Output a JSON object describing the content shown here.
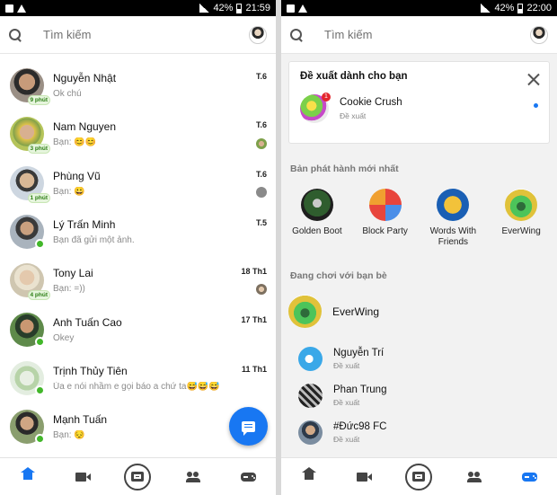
{
  "left": {
    "status": {
      "battery": "42%",
      "time": "21:59"
    },
    "search_placeholder": "Tìm kiếm",
    "conversations": [
      {
        "name": "Nguyễn Nhật",
        "msg": "Ok chú",
        "time": "T.6",
        "badge": "9 phút"
      },
      {
        "name": "Nam Nguyen",
        "msg": "Bạn: 😊😊",
        "time": "T.6",
        "badge": "3 phút"
      },
      {
        "name": "Phùng Vũ",
        "msg": "Bạn: 😀",
        "time": "T.6",
        "badge": "1 phút"
      },
      {
        "name": "Lý Trấn Minh",
        "msg": "Bạn đã gửi một ảnh.",
        "time": "T.5",
        "badge": ""
      },
      {
        "name": "Tony Lai",
        "msg": "Bạn: =))",
        "time": "18 Th1",
        "badge": "4 phút"
      },
      {
        "name": "Anh Tuấn Cao",
        "msg": "Okey",
        "time": "17 Th1",
        "badge": ""
      },
      {
        "name": "Trịnh Thủy Tiên",
        "msg": "Ủa e nói nhầm e gọi báo a chứ ta😅😅😅",
        "time": "11 Th1",
        "badge": ""
      },
      {
        "name": "Mạnh Tuấn",
        "msg": "Bạn: 😔",
        "time": "",
        "badge": ""
      }
    ]
  },
  "right": {
    "status": {
      "battery": "42%",
      "time": "22:00"
    },
    "search_placeholder": "Tìm kiếm",
    "suggest": {
      "title": "Đề xuất dành cho bạn",
      "game_name": "Cookie Crush",
      "game_sub": "Đề xuất",
      "badge": "1"
    },
    "new_releases_title": "Bản phát hành mới nhất",
    "new_games": [
      {
        "name": "Golden Boot"
      },
      {
        "name": "Block Party"
      },
      {
        "name": "Words With Friends"
      },
      {
        "name": "EverWing"
      }
    ],
    "playing_title": "Đang chơi với bạn bè",
    "playing_game": "EverWing",
    "friends": [
      {
        "name": "Nguyễn Trí",
        "sub": "Đề xuất"
      },
      {
        "name": "Phan Trung",
        "sub": "Đề xuất"
      },
      {
        "name": "#Đức98 FC",
        "sub": "Đề xuất"
      }
    ]
  },
  "colors": {
    "accent": "#1877f2",
    "online": "#42b72a"
  },
  "icons": {
    "tabs": [
      "home-icon",
      "video-icon",
      "camera-icon",
      "people-icon",
      "game-controller-icon"
    ]
  }
}
